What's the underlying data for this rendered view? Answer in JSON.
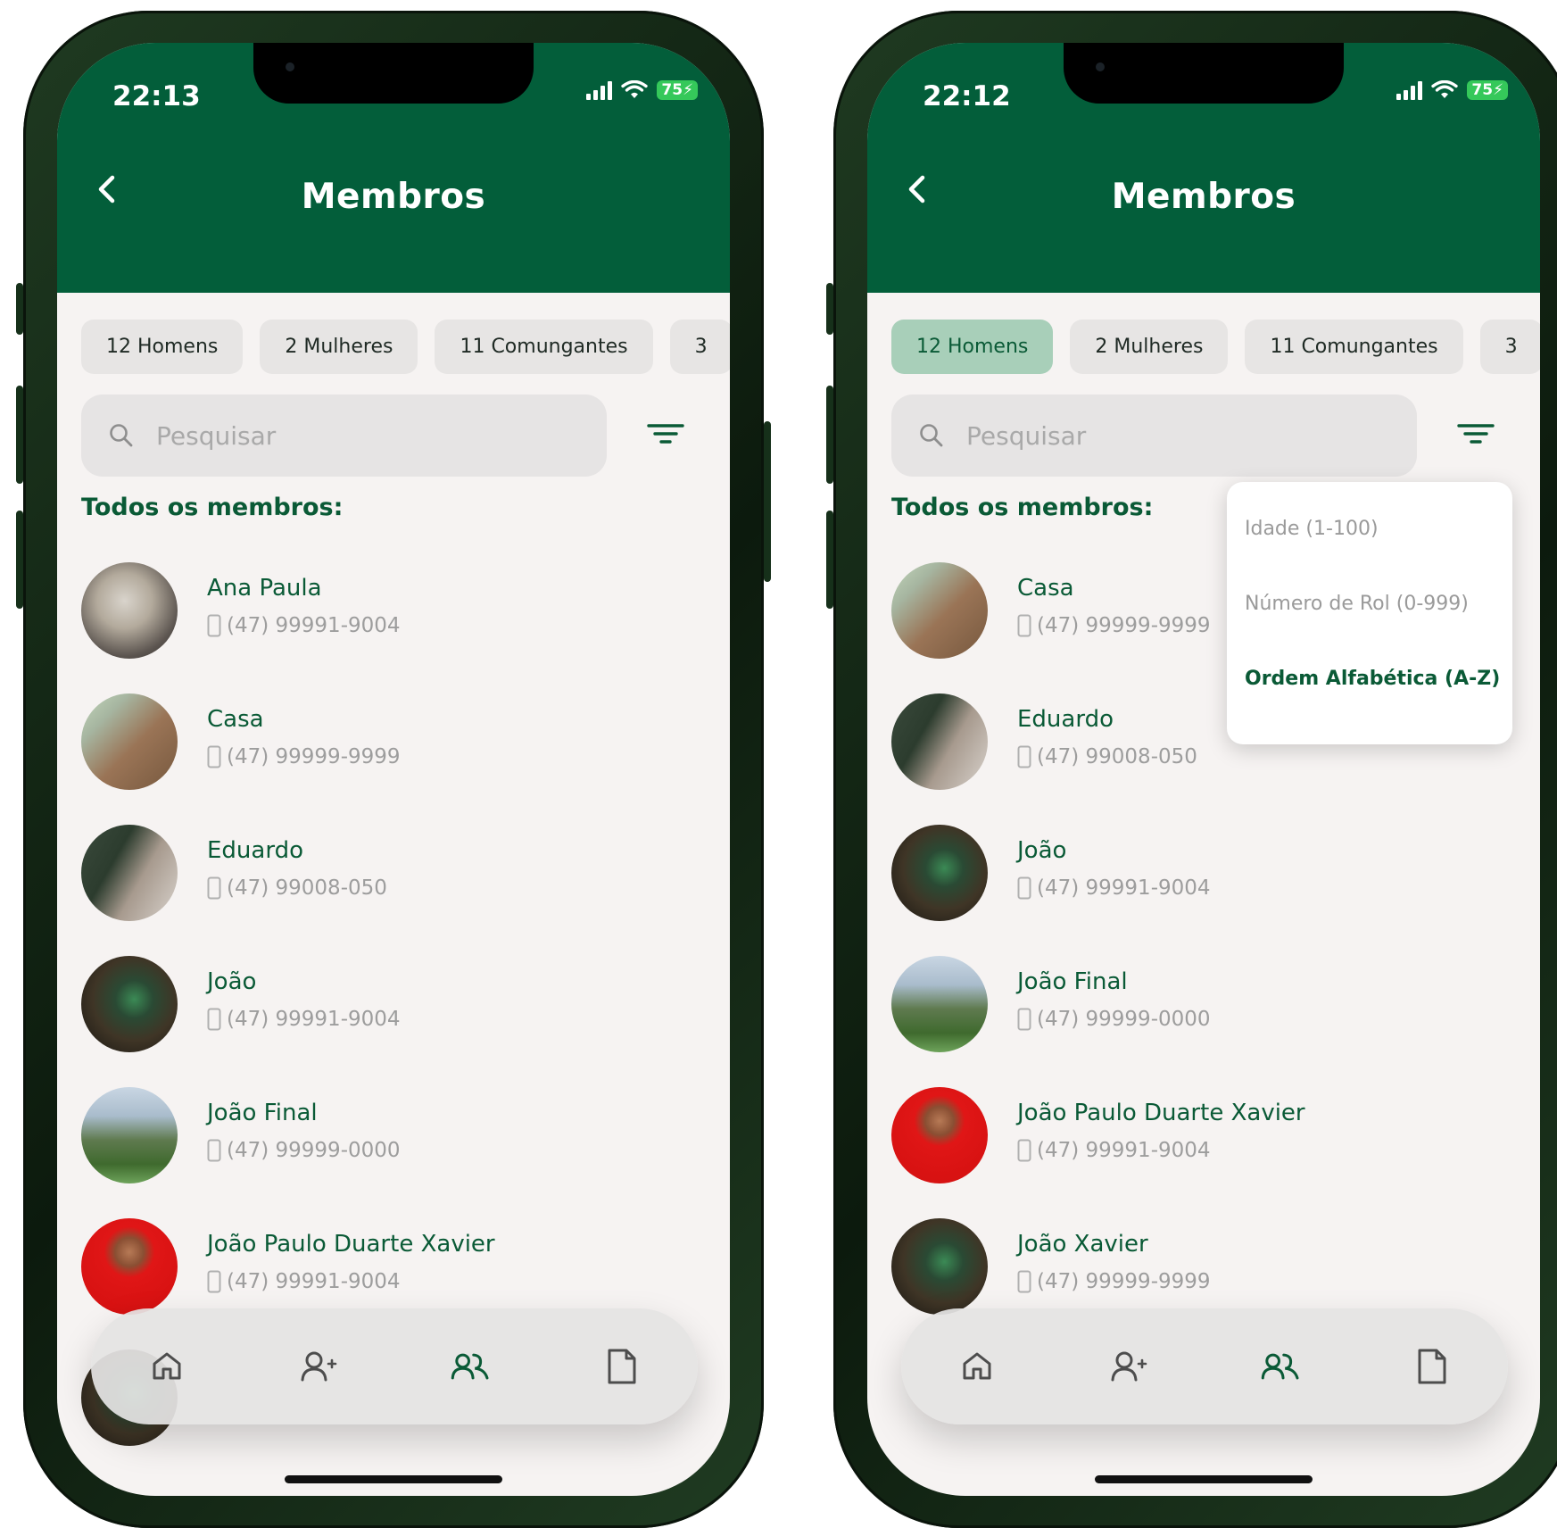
{
  "left": {
    "status": {
      "time": "22:13",
      "battery": "75"
    },
    "header": {
      "title": "Membros"
    },
    "chips": [
      {
        "label": "12 Homens",
        "active": false
      },
      {
        "label": "2 Mulheres",
        "active": false
      },
      {
        "label": "11 Comungantes",
        "active": false
      },
      {
        "label": "3",
        "active": false
      }
    ],
    "search": {
      "placeholder": "Pesquisar"
    },
    "section_label": "Todos os membros:",
    "members": [
      {
        "name": "Ana Paula",
        "phone": "(47) 99991-9004"
      },
      {
        "name": "Casa",
        "phone": "(47) 99999-9999"
      },
      {
        "name": "Eduardo",
        "phone": "(47) 99008-050"
      },
      {
        "name": "João",
        "phone": "(47) 99991-9004"
      },
      {
        "name": "João Final",
        "phone": "(47) 99999-0000"
      },
      {
        "name": "João Paulo Duarte Xavier",
        "phone": "(47) 99991-9004"
      }
    ],
    "nav": [
      {
        "icon": "home-icon"
      },
      {
        "icon": "add-user-icon"
      },
      {
        "icon": "users-icon",
        "active": true
      },
      {
        "icon": "document-icon"
      }
    ]
  },
  "right": {
    "status": {
      "time": "22:12",
      "battery": "75"
    },
    "header": {
      "title": "Membros"
    },
    "chips": [
      {
        "label": "12 Homens",
        "active": true
      },
      {
        "label": "2 Mulheres",
        "active": false
      },
      {
        "label": "11 Comungantes",
        "active": false
      },
      {
        "label": "3",
        "active": false
      }
    ],
    "search": {
      "placeholder": "Pesquisar"
    },
    "section_label": "Todos os membros:",
    "sort_menu": {
      "options": [
        {
          "label": "Idade (1-100)",
          "selected": false
        },
        {
          "label": "Número de Rol (0-999)",
          "selected": false
        },
        {
          "label": "Ordem Alfabética (A-Z)",
          "selected": true
        }
      ]
    },
    "members": [
      {
        "name": "Casa",
        "phone": "(47) 99999-9999"
      },
      {
        "name": "Eduardo",
        "phone": "(47) 99008-050"
      },
      {
        "name": "João",
        "phone": "(47) 99991-9004"
      },
      {
        "name": "João Final",
        "phone": "(47) 99999-0000"
      },
      {
        "name": "João Paulo Duarte Xavier",
        "phone": "(47) 99991-9004"
      },
      {
        "name": "João Xavier",
        "phone": "(47) 99999-9999"
      }
    ],
    "nav": [
      {
        "icon": "home-icon"
      },
      {
        "icon": "add-user-icon"
      },
      {
        "icon": "users-icon",
        "active": true
      },
      {
        "icon": "document-icon"
      }
    ]
  },
  "colors": {
    "primary": "#035e3a",
    "chip_active_bg": "#a8cfb9",
    "background": "#f6f3f2",
    "text_muted": "#9d9d9d"
  }
}
